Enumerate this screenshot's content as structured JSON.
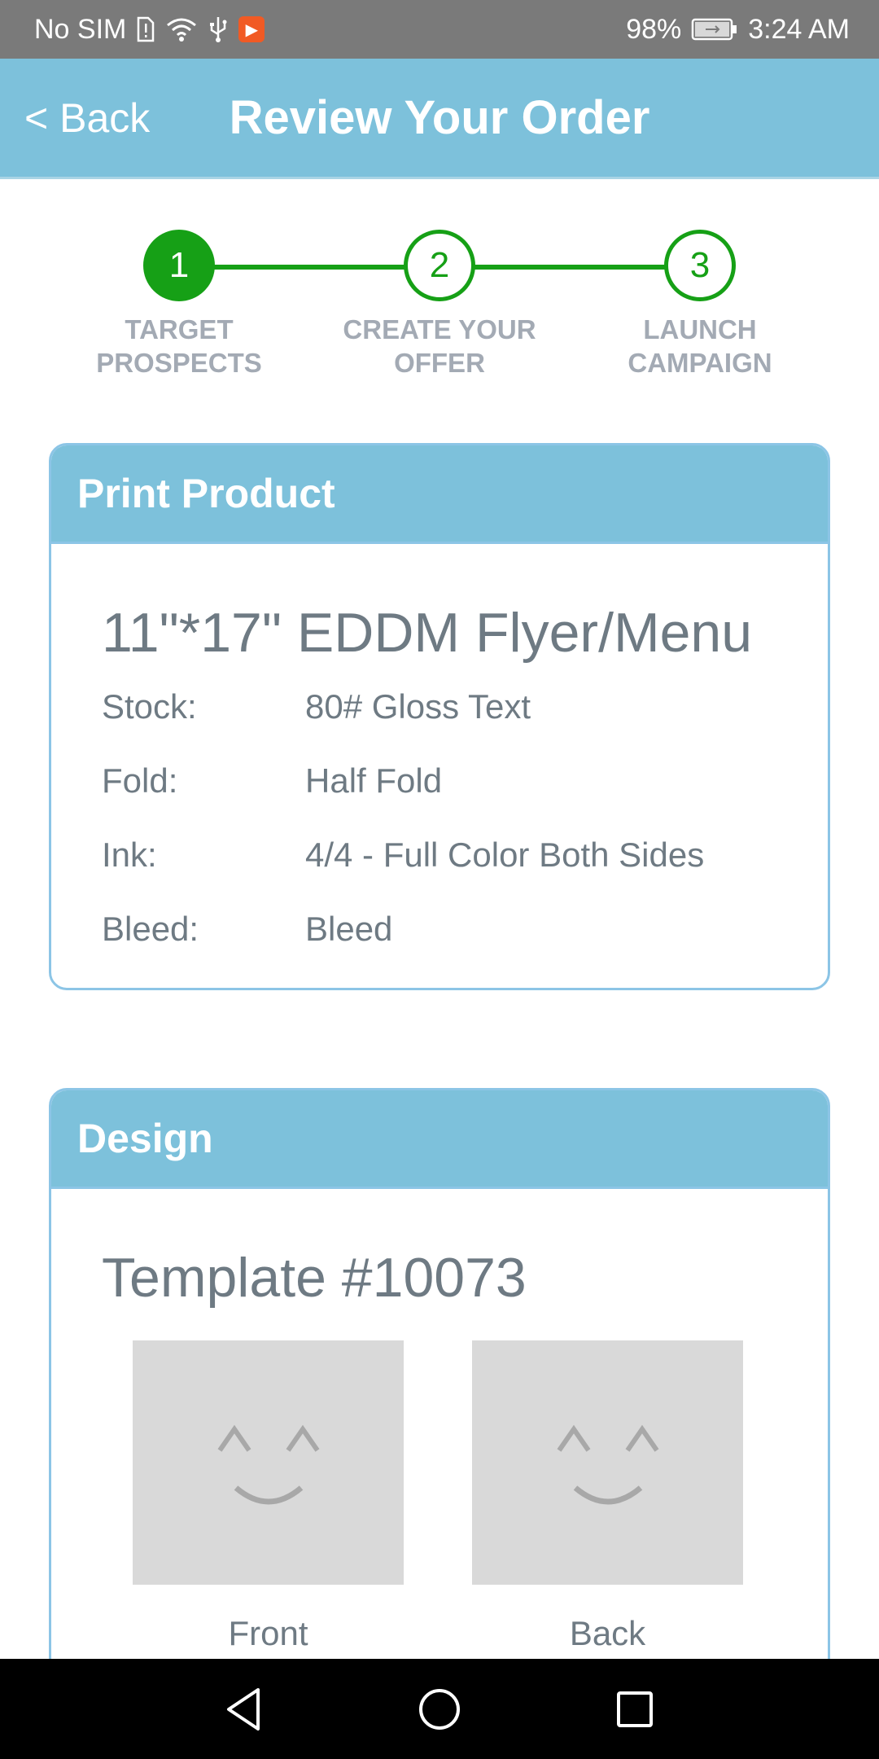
{
  "status_bar": {
    "carrier": "No SIM",
    "battery": "98%",
    "time": "3:24 AM"
  },
  "header": {
    "back_label": "< Back",
    "title": "Review Your Order"
  },
  "stepper": {
    "steps": [
      {
        "number": "1",
        "label": "TARGET\nPROSPECTS",
        "active": true
      },
      {
        "number": "2",
        "label": "CREATE YOUR\nOFFER",
        "active": false
      },
      {
        "number": "3",
        "label": "LAUNCH\nCAMPAIGN",
        "active": false
      }
    ]
  },
  "print_product": {
    "header": "Print Product",
    "title": "11\"*17\" EDDM Flyer/Menu",
    "specs": [
      {
        "label": "Stock:",
        "value": "80# Gloss Text"
      },
      {
        "label": "Fold:",
        "value": "Half Fold"
      },
      {
        "label": "Ink:",
        "value": "4/4 - Full Color Both Sides"
      },
      {
        "label": "Bleed:",
        "value": "Bleed"
      }
    ]
  },
  "design": {
    "header": "Design",
    "template_title": "Template #10073",
    "thumbnails": [
      {
        "caption": "Front",
        "icon": "placeholder-face-icon"
      },
      {
        "caption": "Back",
        "icon": "placeholder-face-icon"
      }
    ]
  },
  "colors": {
    "header_bg": "#7dc1db",
    "step_green": "#16a016",
    "muted_text": "#6e7a83",
    "step_label": "#a3aab4"
  },
  "nav_icons": [
    "back-triangle-icon",
    "home-circle-icon",
    "recents-square-icon"
  ]
}
